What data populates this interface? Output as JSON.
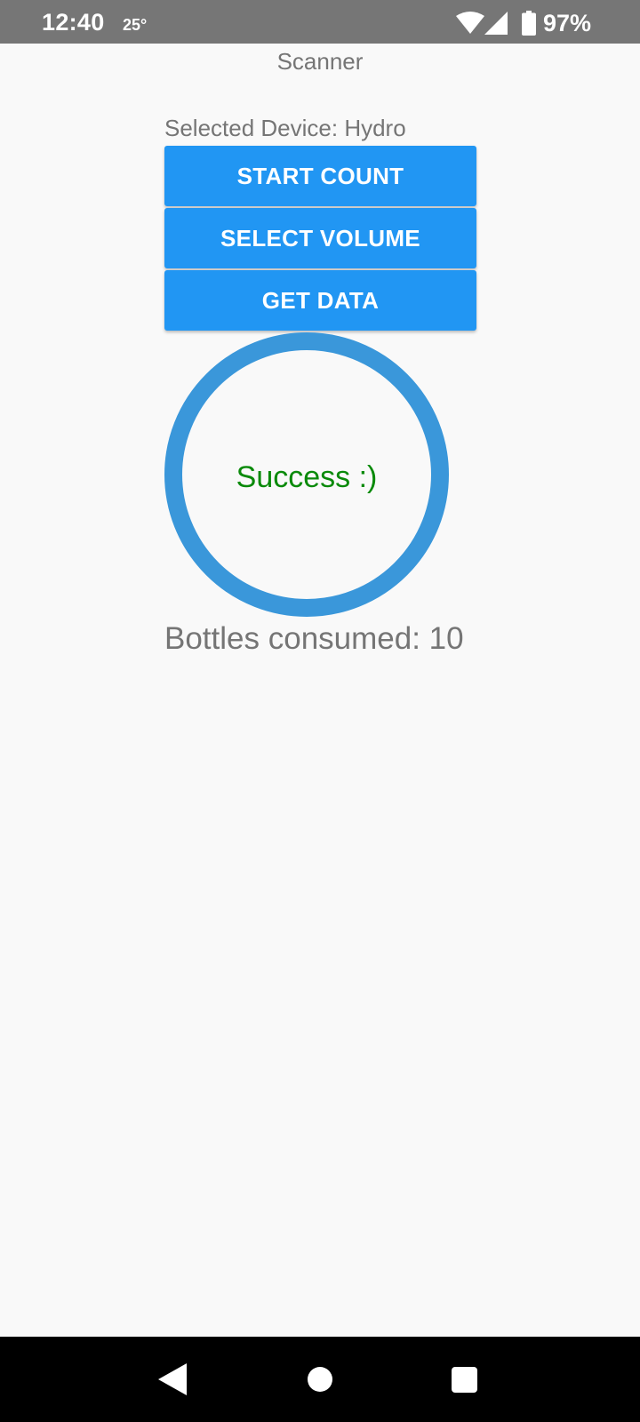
{
  "status_bar": {
    "time": "12:40",
    "temperature": "25°",
    "battery_percent": "97%",
    "icons": [
      "wifi-icon",
      "signal-icon",
      "battery-icon"
    ]
  },
  "app": {
    "title": "Scanner",
    "selected_device_label": "Selected Device: Hydro"
  },
  "buttons": {
    "start_count": "START COUNT",
    "select_volume": "SELECT VOLUME",
    "get_data": "GET DATA"
  },
  "progress": {
    "message": "Success :)",
    "progress_fraction": 1.0,
    "ring_color": "#3a97da",
    "message_color": "#0a8a0a"
  },
  "result": {
    "bottles_consumed_label": "Bottles consumed: 10"
  },
  "colors": {
    "button_bg": "#2196f3",
    "status_bar_bg": "#767676",
    "text_gray": "#757575"
  },
  "nav_bar": {
    "icons": [
      "back-icon",
      "home-icon",
      "recents-icon"
    ]
  }
}
